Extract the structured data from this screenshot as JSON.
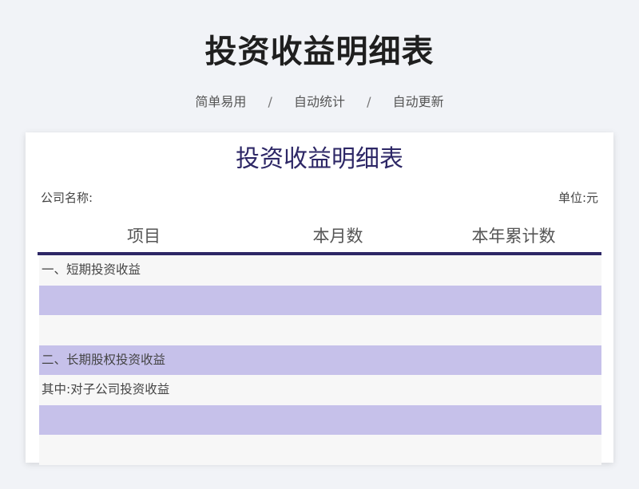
{
  "header": {
    "title": "投资收益明细表",
    "tags": [
      "简单易用",
      "自动统计",
      "自动更新"
    ],
    "separator": "/"
  },
  "sheet": {
    "title": "投资收益明细表",
    "company_label": "公司名称:",
    "unit_label": "单位:元",
    "columns": [
      "项目",
      "本月数",
      "本年累计数"
    ],
    "rows": [
      {
        "item": "一、短期投资收益",
        "shaded": false
      },
      {
        "item": "",
        "shaded": true
      },
      {
        "item": "",
        "shaded": false
      },
      {
        "item": "二、长期股权投资收益",
        "shaded": true
      },
      {
        "item": "其中:对子公司投资收益",
        "shaded": false
      },
      {
        "item": "",
        "shaded": true
      },
      {
        "item": "",
        "shaded": false
      }
    ]
  },
  "colors": {
    "accent": "#2d2766",
    "row_shade": "#c6c1ea",
    "row_plain": "#f7f7f7",
    "background": "#f1f3f7"
  }
}
